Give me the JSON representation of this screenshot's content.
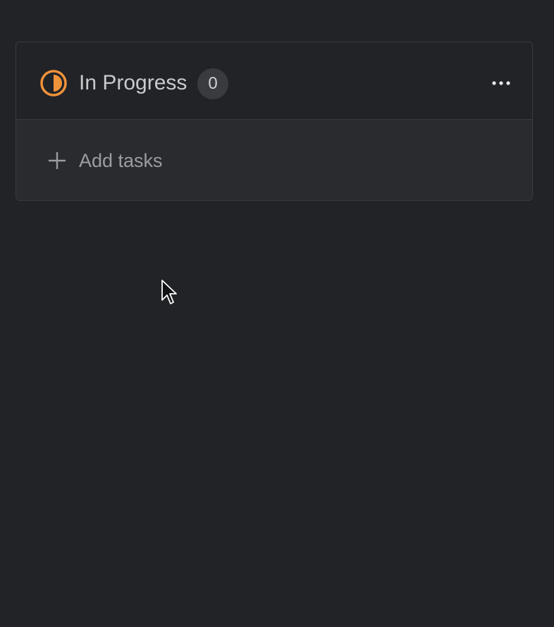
{
  "column": {
    "title": "In Progress",
    "count": "0",
    "status_icon": "half-progress-circle-icon",
    "more_icon": "more-horizontal-icon",
    "add_label": "Add tasks",
    "add_icon": "plus-icon"
  },
  "colors": {
    "background": "#222327",
    "status_accent": "#f0923a",
    "border": "#3a3b40"
  }
}
